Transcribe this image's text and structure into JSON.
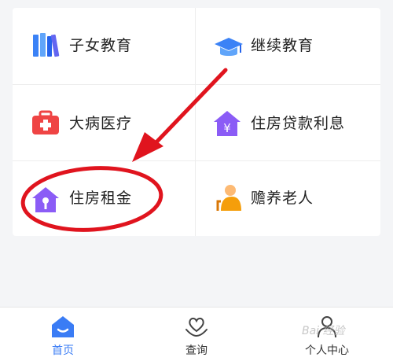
{
  "menu": {
    "items": [
      {
        "label": "子女教育",
        "icon": "books-icon"
      },
      {
        "label": "继续教育",
        "icon": "graduation-cap-icon"
      },
      {
        "label": "大病医疗",
        "icon": "medical-kit-icon"
      },
      {
        "label": "住房贷款利息",
        "icon": "house-loan-icon"
      },
      {
        "label": "住房租金",
        "icon": "house-rent-icon"
      },
      {
        "label": "赡养老人",
        "icon": "elderly-care-icon"
      }
    ]
  },
  "tabbar": {
    "tabs": [
      {
        "label": "首页",
        "icon": "home-icon",
        "active": true
      },
      {
        "label": "查询",
        "icon": "heart-hand-icon",
        "active": false
      },
      {
        "label": "个人中心",
        "icon": "person-icon",
        "active": false
      }
    ]
  },
  "watermark": "Bai 经验",
  "colors": {
    "accent": "#3a7cf5",
    "annotation": "#e0141e"
  }
}
